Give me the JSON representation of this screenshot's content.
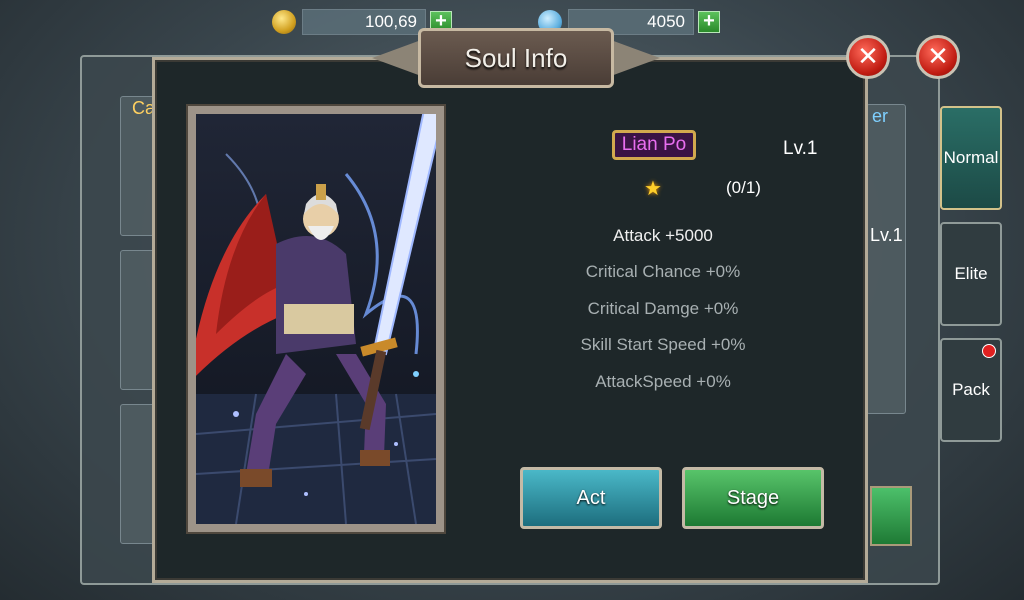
{
  "currency": {
    "coins": "100,69",
    "gems": "4050",
    "coin_icon": "coin-icon",
    "gem_icon": "gem-icon"
  },
  "background": {
    "left_label": "Ca",
    "right_label": "er",
    "hero_level": "Lv.1",
    "tabs": [
      {
        "label": "Normal",
        "active": true
      },
      {
        "label": "Elite",
        "active": false
      },
      {
        "label": "Pack",
        "active": false,
        "notification": true
      }
    ]
  },
  "dialog": {
    "title": "Soul Info",
    "hero_name": "Lian Po",
    "level": "Lv.1",
    "star_icon": "star-icon",
    "star_progress": "(0/1)",
    "stats": [
      {
        "label": "Attack +5000",
        "active": true
      },
      {
        "label": "Critical Chance +0%",
        "active": false
      },
      {
        "label": "Critical Damge +0%",
        "active": false
      },
      {
        "label": "Skill Start Speed +0%",
        "active": false
      },
      {
        "label": "AttackSpeed +0%",
        "active": false
      }
    ],
    "act_button": "Act",
    "stage_button": "Stage",
    "close_glyph": "✕"
  },
  "colors": {
    "name_color": "#e86ef0",
    "act_button": "#2a8fa0",
    "stage_button": "#2ea048",
    "close_button": "#d02418"
  }
}
